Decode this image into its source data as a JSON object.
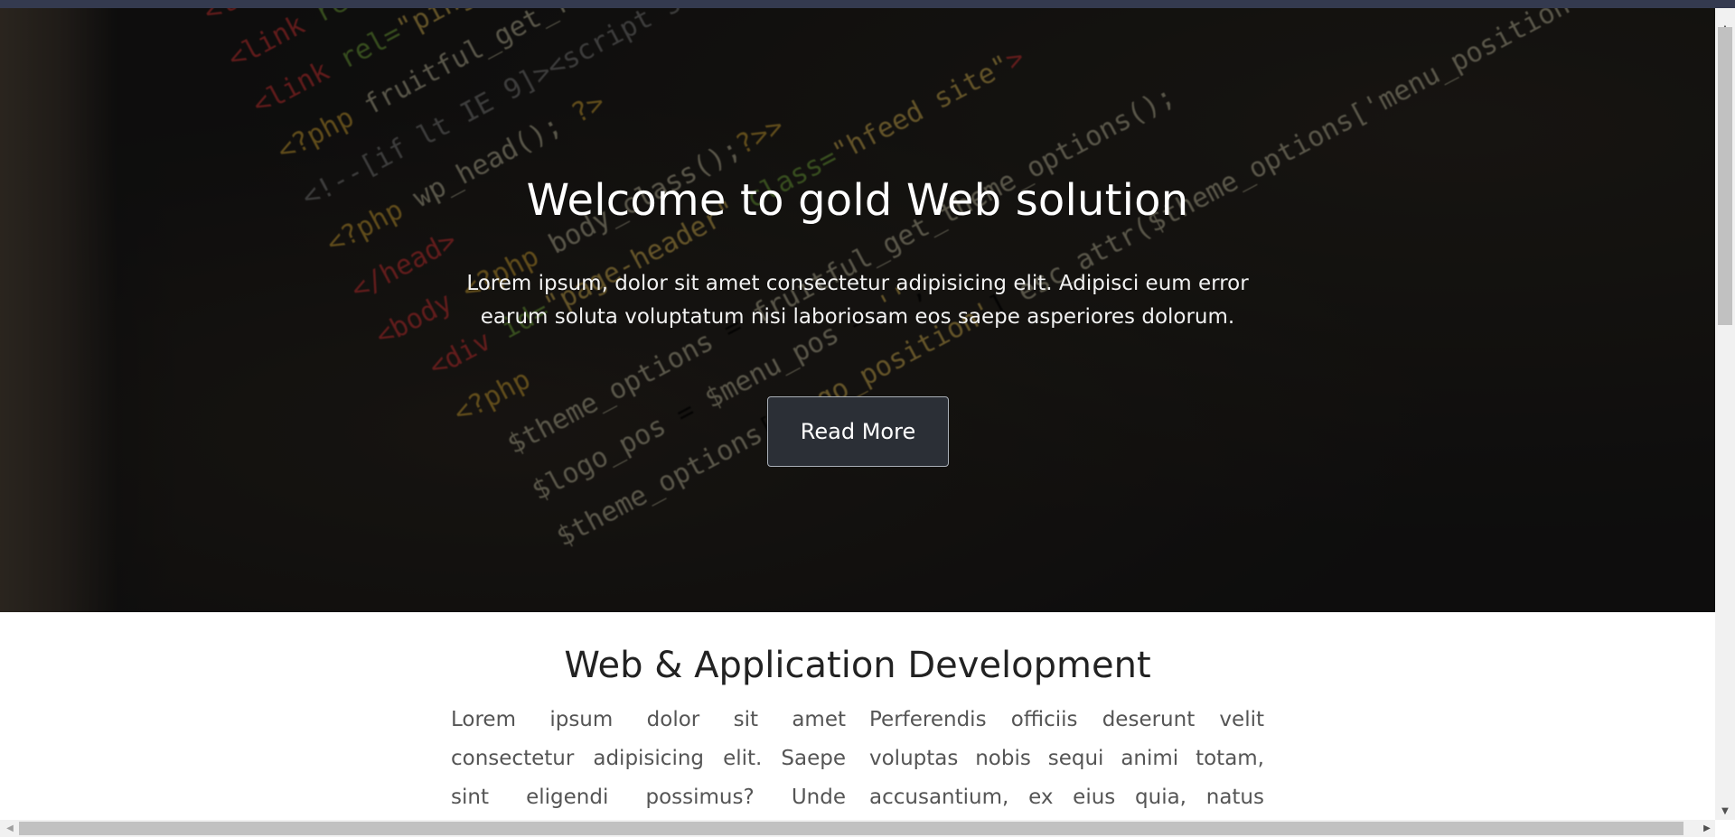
{
  "hero": {
    "title": "Welcome to gold Web solution",
    "text": "Lorem ipsum, dolor sit amet consectetur adipisicing elit. Adipisci eum error earum soluta voluptatum nisi laboriosam eos saepe asperiores dolorum.",
    "button_label": "Read More"
  },
  "section": {
    "title": "Web & Application Development",
    "col_left": "Lorem ipsum dolor sit amet consectetur adipisicing elit. Saepe sint eligendi possimus? Unde",
    "col_right": "Perferendis officiis deserunt velit voluptas nobis sequi animi totam, accusantium, ex eius quia, natus"
  },
  "icons": {
    "scroll_up": "up-arrow-icon",
    "scroll_down": "down-arrow-icon",
    "scroll_left": "left-arrow-icon",
    "scroll_right": "right-arrow-icon"
  },
  "colors": {
    "topbar": "#343a4f",
    "button_bg": "#2b2f36",
    "heading_dark": "#222222"
  }
}
